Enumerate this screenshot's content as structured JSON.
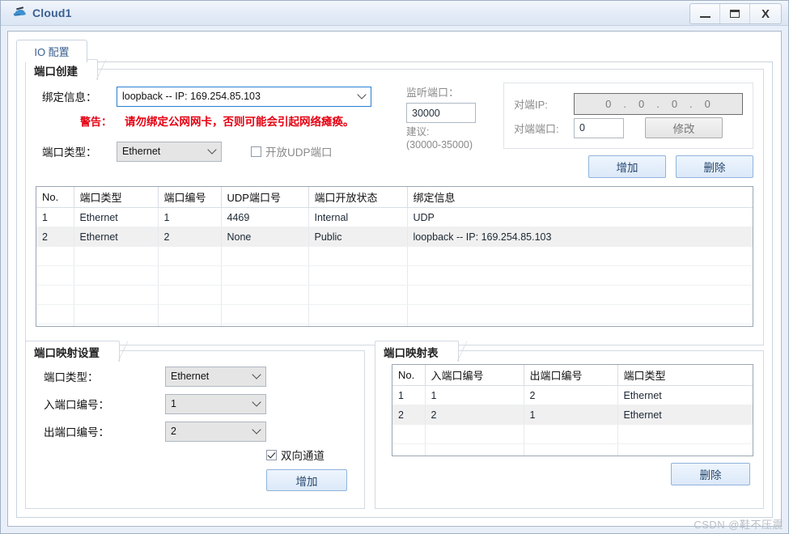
{
  "window": {
    "title": "Cloud1",
    "icon": "cloud-icon",
    "buttons": {
      "minimize": "–",
      "maximize": "❐",
      "close": "X"
    }
  },
  "tabs": [
    {
      "label": "IO 配置",
      "selected": true
    }
  ],
  "port_create": {
    "legend": "端口创建",
    "binding_label": "绑定信息：",
    "binding_value": "loopback -- IP: 169.254.85.103",
    "warning_label": "警告：",
    "warning_text": "请勿绑定公网网卡，否则可能会引起网络瘫痪。",
    "port_type_label": "端口类型：",
    "port_type_value": "Ethernet",
    "udp_checkbox_label": "开放UDP端口",
    "udp_checkbox_checked": false,
    "listen_port_label": "监听端口：",
    "listen_port_value": "30000",
    "suggest_label": "建议:",
    "suggest_range": "(30000-35000)",
    "peer_ip_label": "对端IP:",
    "peer_ip_octets": [
      "0",
      "0",
      "0",
      "0"
    ],
    "peer_port_label": "对端端口:",
    "peer_port_value": "0",
    "modify_button": "修改",
    "add_button": "增加",
    "delete_button": "删除"
  },
  "port_table": {
    "headers": [
      "No.",
      "端口类型",
      "端口编号",
      "UDP端口号",
      "端口开放状态",
      "绑定信息"
    ],
    "rows": [
      {
        "cells": [
          "1",
          "Ethernet",
          "1",
          "4469",
          "Internal",
          "UDP"
        ],
        "selected": false
      },
      {
        "cells": [
          "2",
          "Ethernet",
          "2",
          "None",
          "Public",
          "loopback -- IP: 169.254.85.103"
        ],
        "selected": true
      }
    ],
    "empty_rows": 5
  },
  "map_settings": {
    "legend": "端口映射设置",
    "port_type_label": "端口类型：",
    "port_type_value": "Ethernet",
    "in_port_label": "入端口编号：",
    "in_port_value": "1",
    "out_port_label": "出端口编号：",
    "out_port_value": "2",
    "bidirectional_label": "双向通道",
    "bidirectional_checked": true,
    "add_button": "增加"
  },
  "map_table": {
    "legend": "端口映射表",
    "headers": [
      "No.",
      "入端口编号",
      "出端口编号",
      "端口类型"
    ],
    "rows": [
      {
        "cells": [
          "1",
          "1",
          "2",
          "Ethernet"
        ],
        "selected": false
      },
      {
        "cells": [
          "2",
          "2",
          "1",
          "Ethernet"
        ],
        "selected": true
      }
    ],
    "empty_rows": 3,
    "delete_button": "删除"
  },
  "watermark": "CSDN @鞋不压震",
  "colors": {
    "accent": "#3b6090",
    "warning": "#e60012",
    "frame": "#e9eff9",
    "button_blue_border": "#8fb4dc",
    "selection": "#f0f0f0"
  }
}
